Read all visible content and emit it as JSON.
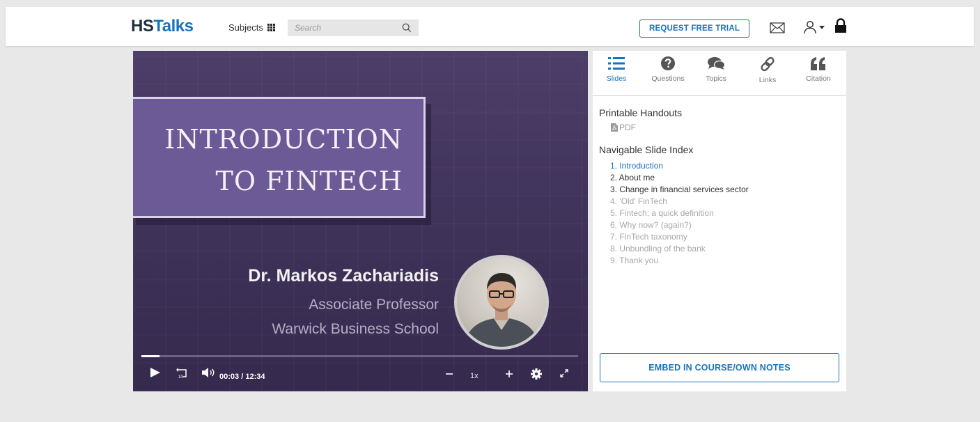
{
  "header": {
    "logo_hs": "HS",
    "logo_talks": "Talks",
    "subjects_label": "Subjects",
    "search_placeholder": "Search",
    "trial_button": "REQUEST FREE TRIAL"
  },
  "video": {
    "title_line1": "INTRODUCTION",
    "title_line2": "TO FINTECH",
    "speaker_name": "Dr. Markos Zachariadis",
    "speaker_role": "Associate Professor",
    "speaker_org": "Warwick Business School",
    "current_time": "00:03",
    "time_separator": "/",
    "duration": "12:34",
    "playback_speed": "1x",
    "progress_fraction": 0.004
  },
  "panel": {
    "tabs": [
      {
        "label": "Slides",
        "icon": "list-icon",
        "active": true
      },
      {
        "label": "Questions",
        "icon": "question-circle-icon",
        "active": false
      },
      {
        "label": "Topics",
        "icon": "comments-icon",
        "active": false
      },
      {
        "label": "Links",
        "icon": "link-icon",
        "active": false
      },
      {
        "label": "Citation",
        "icon": "quote-icon",
        "active": false
      }
    ],
    "handouts_title": "Printable Handouts",
    "pdf_label": "PDF",
    "index_title": "Navigable Slide Index",
    "slides": [
      {
        "text": "1. Introduction",
        "state": "current"
      },
      {
        "text": "2. About me",
        "state": "done"
      },
      {
        "text": "3. Change in financial services sector",
        "state": "done"
      },
      {
        "text": "4. 'Old' FinTech",
        "state": "upcoming"
      },
      {
        "text": "5. Fintech: a quick definition",
        "state": "upcoming"
      },
      {
        "text": "6. Why now? (again?)",
        "state": "upcoming"
      },
      {
        "text": "7. FinTech taxonomy",
        "state": "upcoming"
      },
      {
        "text": "8. Unbundling of the bank",
        "state": "upcoming"
      },
      {
        "text": "9. Thank you",
        "state": "upcoming"
      }
    ],
    "embed_button": "EMBED IN COURSE/OWN NOTES"
  },
  "colors": {
    "brand_blue": "#1a72bd",
    "video_bg": "#3d3157",
    "title_box": "#6c5a96"
  }
}
